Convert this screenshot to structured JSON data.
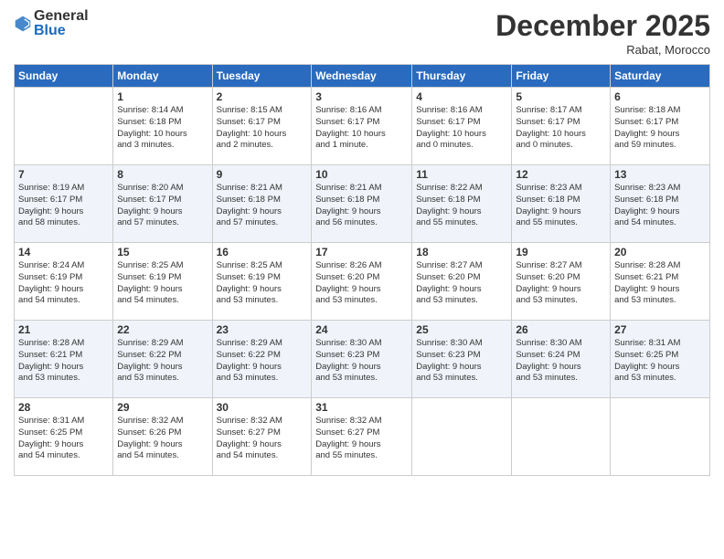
{
  "header": {
    "logo": {
      "general": "General",
      "blue": "Blue"
    },
    "title": "December 2025",
    "subtitle": "Rabat, Morocco"
  },
  "weekdays": [
    "Sunday",
    "Monday",
    "Tuesday",
    "Wednesday",
    "Thursday",
    "Friday",
    "Saturday"
  ],
  "weeks": [
    [
      {
        "day": "",
        "info": ""
      },
      {
        "day": "1",
        "info": "Sunrise: 8:14 AM\nSunset: 6:18 PM\nDaylight: 10 hours\nand 3 minutes."
      },
      {
        "day": "2",
        "info": "Sunrise: 8:15 AM\nSunset: 6:17 PM\nDaylight: 10 hours\nand 2 minutes."
      },
      {
        "day": "3",
        "info": "Sunrise: 8:16 AM\nSunset: 6:17 PM\nDaylight: 10 hours\nand 1 minute."
      },
      {
        "day": "4",
        "info": "Sunrise: 8:16 AM\nSunset: 6:17 PM\nDaylight: 10 hours\nand 0 minutes."
      },
      {
        "day": "5",
        "info": "Sunrise: 8:17 AM\nSunset: 6:17 PM\nDaylight: 10 hours\nand 0 minutes."
      },
      {
        "day": "6",
        "info": "Sunrise: 8:18 AM\nSunset: 6:17 PM\nDaylight: 9 hours\nand 59 minutes."
      }
    ],
    [
      {
        "day": "7",
        "info": "Sunrise: 8:19 AM\nSunset: 6:17 PM\nDaylight: 9 hours\nand 58 minutes."
      },
      {
        "day": "8",
        "info": "Sunrise: 8:20 AM\nSunset: 6:17 PM\nDaylight: 9 hours\nand 57 minutes."
      },
      {
        "day": "9",
        "info": "Sunrise: 8:21 AM\nSunset: 6:18 PM\nDaylight: 9 hours\nand 57 minutes."
      },
      {
        "day": "10",
        "info": "Sunrise: 8:21 AM\nSunset: 6:18 PM\nDaylight: 9 hours\nand 56 minutes."
      },
      {
        "day": "11",
        "info": "Sunrise: 8:22 AM\nSunset: 6:18 PM\nDaylight: 9 hours\nand 55 minutes."
      },
      {
        "day": "12",
        "info": "Sunrise: 8:23 AM\nSunset: 6:18 PM\nDaylight: 9 hours\nand 55 minutes."
      },
      {
        "day": "13",
        "info": "Sunrise: 8:23 AM\nSunset: 6:18 PM\nDaylight: 9 hours\nand 54 minutes."
      }
    ],
    [
      {
        "day": "14",
        "info": "Sunrise: 8:24 AM\nSunset: 6:19 PM\nDaylight: 9 hours\nand 54 minutes."
      },
      {
        "day": "15",
        "info": "Sunrise: 8:25 AM\nSunset: 6:19 PM\nDaylight: 9 hours\nand 54 minutes."
      },
      {
        "day": "16",
        "info": "Sunrise: 8:25 AM\nSunset: 6:19 PM\nDaylight: 9 hours\nand 53 minutes."
      },
      {
        "day": "17",
        "info": "Sunrise: 8:26 AM\nSunset: 6:20 PM\nDaylight: 9 hours\nand 53 minutes."
      },
      {
        "day": "18",
        "info": "Sunrise: 8:27 AM\nSunset: 6:20 PM\nDaylight: 9 hours\nand 53 minutes."
      },
      {
        "day": "19",
        "info": "Sunrise: 8:27 AM\nSunset: 6:20 PM\nDaylight: 9 hours\nand 53 minutes."
      },
      {
        "day": "20",
        "info": "Sunrise: 8:28 AM\nSunset: 6:21 PM\nDaylight: 9 hours\nand 53 minutes."
      }
    ],
    [
      {
        "day": "21",
        "info": "Sunrise: 8:28 AM\nSunset: 6:21 PM\nDaylight: 9 hours\nand 53 minutes."
      },
      {
        "day": "22",
        "info": "Sunrise: 8:29 AM\nSunset: 6:22 PM\nDaylight: 9 hours\nand 53 minutes."
      },
      {
        "day": "23",
        "info": "Sunrise: 8:29 AM\nSunset: 6:22 PM\nDaylight: 9 hours\nand 53 minutes."
      },
      {
        "day": "24",
        "info": "Sunrise: 8:30 AM\nSunset: 6:23 PM\nDaylight: 9 hours\nand 53 minutes."
      },
      {
        "day": "25",
        "info": "Sunrise: 8:30 AM\nSunset: 6:23 PM\nDaylight: 9 hours\nand 53 minutes."
      },
      {
        "day": "26",
        "info": "Sunrise: 8:30 AM\nSunset: 6:24 PM\nDaylight: 9 hours\nand 53 minutes."
      },
      {
        "day": "27",
        "info": "Sunrise: 8:31 AM\nSunset: 6:25 PM\nDaylight: 9 hours\nand 53 minutes."
      }
    ],
    [
      {
        "day": "28",
        "info": "Sunrise: 8:31 AM\nSunset: 6:25 PM\nDaylight: 9 hours\nand 54 minutes."
      },
      {
        "day": "29",
        "info": "Sunrise: 8:32 AM\nSunset: 6:26 PM\nDaylight: 9 hours\nand 54 minutes."
      },
      {
        "day": "30",
        "info": "Sunrise: 8:32 AM\nSunset: 6:27 PM\nDaylight: 9 hours\nand 54 minutes."
      },
      {
        "day": "31",
        "info": "Sunrise: 8:32 AM\nSunset: 6:27 PM\nDaylight: 9 hours\nand 55 minutes."
      },
      {
        "day": "",
        "info": ""
      },
      {
        "day": "",
        "info": ""
      },
      {
        "day": "",
        "info": ""
      }
    ]
  ]
}
